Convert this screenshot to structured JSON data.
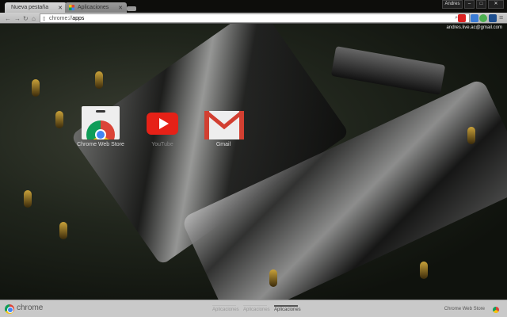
{
  "tabs": [
    {
      "label": "Nueva pestaña",
      "active": true
    },
    {
      "label": "Aplicaciones",
      "active": false
    }
  ],
  "window": {
    "user": "Andres",
    "minimize": "–",
    "maximize": "□",
    "close": "✕"
  },
  "toolbar": {
    "url_scheme": "chrome://",
    "url_host": "apps"
  },
  "account": "andres.live.ac@gmail.com",
  "apps": [
    {
      "label": "Chrome Web Store"
    },
    {
      "label": "YouTube"
    },
    {
      "label": "Gmail"
    }
  ],
  "bottom": {
    "brand": "chrome",
    "pages": [
      "Aplicaciones",
      "Aplicaciones",
      "Aplicaciones"
    ],
    "active_page": 2,
    "web_store": "Chrome Web Store"
  }
}
